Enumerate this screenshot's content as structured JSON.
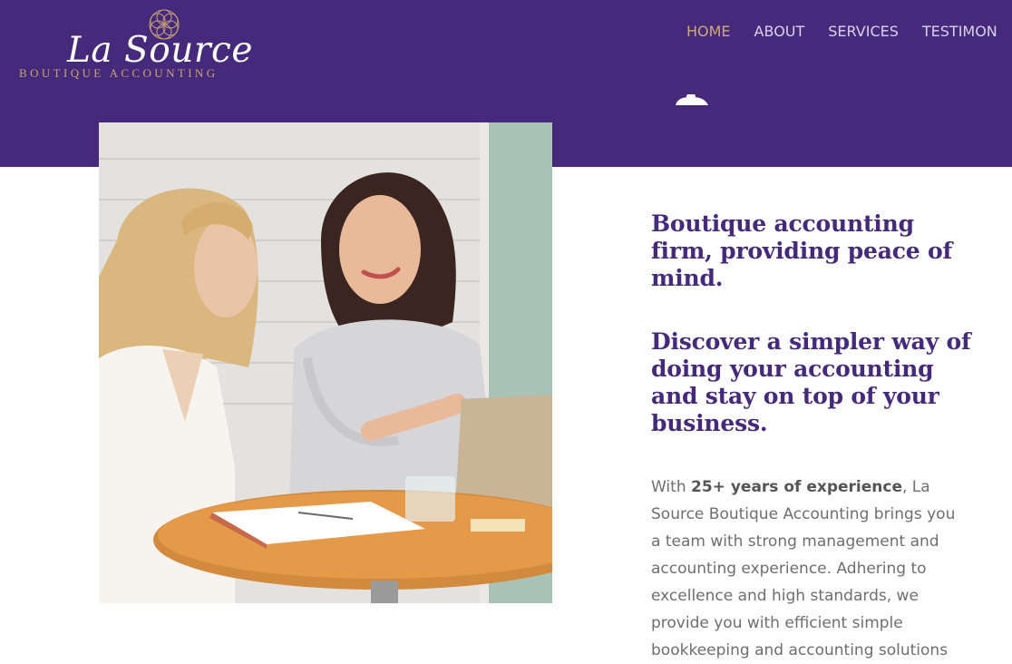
{
  "brand": {
    "name": "La Source",
    "subtitle": "BOUTIQUE ACCOUNTING"
  },
  "nav": {
    "items": [
      {
        "label": "HOME",
        "active": true
      },
      {
        "label": "ABOUT",
        "active": false
      },
      {
        "label": "SERVICES",
        "active": false
      },
      {
        "label": "TESTIMON",
        "active": false
      }
    ]
  },
  "hero": {
    "tagline": "Boutique accounting firm, providing peace of mind.",
    "subhead": "Discover a simpler way of doing your accounting and stay on top of your business.",
    "body_prefix": "With ",
    "body_bold": "25+ years of experience",
    "body_rest": ", La Source Boutique Accounting brings you a team with strong management and accounting experience. Adhering to excellence and high standards, we provide you with efficient simple bookkeeping and accounting solutions"
  },
  "icons": {
    "logo_mark": "flower-of-life-icon",
    "scroll_indicator": "scroll-down-icon"
  },
  "colors": {
    "header_bg": "#452a7c",
    "accent_gold": "#cfa87a",
    "heading_purple": "#452a7c",
    "body_gray": "#6e6e6e"
  }
}
